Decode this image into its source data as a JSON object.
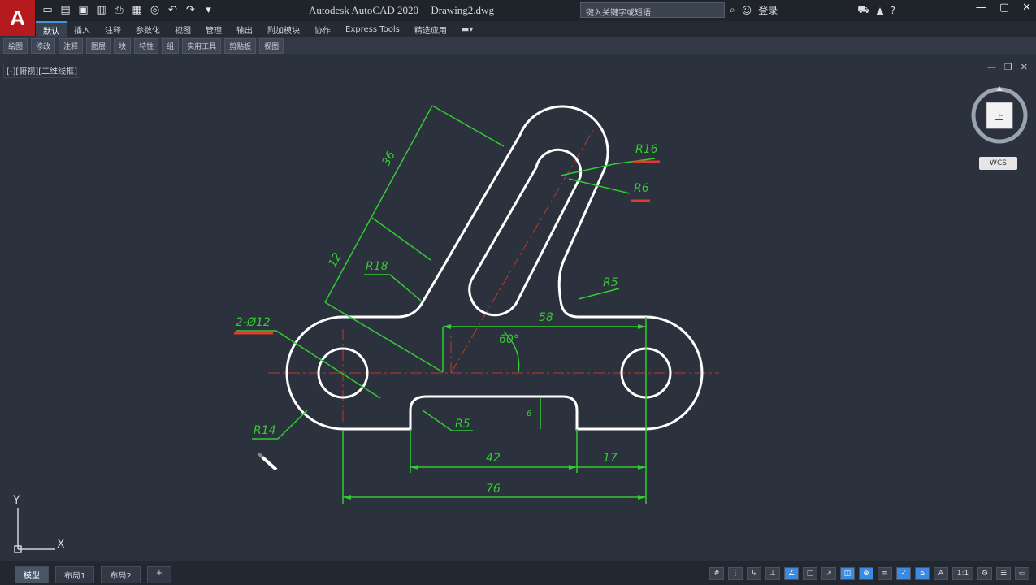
{
  "app": {
    "logo": "A",
    "title": "Autodesk AutoCAD 2020",
    "filename": "Drawing2.dwg",
    "search_placeholder": "键入关键字或短语",
    "user": "登录",
    "colors": {
      "titlebar": "#1f232a",
      "canvas": "#2b313d",
      "geometry": "#ffffff",
      "dimension": "#33cc33",
      "centerline": "#cc3333",
      "accent": "#3c8be0"
    }
  },
  "ribbon": {
    "tabs": [
      "默认",
      "插入",
      "注释",
      "参数化",
      "视图",
      "管理",
      "输出",
      "附加模块",
      "协作",
      "Express Tools",
      "精选应用"
    ],
    "panels": [
      "绘图",
      "修改",
      "注释",
      "图层",
      "块",
      "特性",
      "组",
      "实用工具",
      "剪贴板",
      "视图"
    ]
  },
  "viewport": {
    "label": "[-][俯视][二维线框]",
    "wcs": "WCS",
    "compass_top": "上"
  },
  "drawing": {
    "dims": {
      "d36": "36",
      "d12": "12",
      "d58": "58",
      "d42": "42",
      "d17": "17",
      "d76": "76",
      "d6": "6",
      "r18": "R18",
      "r16": "R16",
      "r6": "R6",
      "r5a": "R5",
      "r5b": "R5",
      "r14": "R14",
      "holes": "2-Ø12",
      "angle": "60°"
    },
    "ucs_x": "X",
    "ucs_y": "Y"
  },
  "status": {
    "layout_tabs": [
      "模型",
      "布局1",
      "布局2"
    ],
    "scale": "1:1",
    "tools": [
      "#",
      "⋮",
      "↳",
      "⊥",
      "∠",
      "□",
      "↗",
      "◫",
      "⊕",
      "≡",
      "✓",
      "⌂",
      "A",
      "+",
      "⚙",
      "☰",
      "▭"
    ]
  }
}
